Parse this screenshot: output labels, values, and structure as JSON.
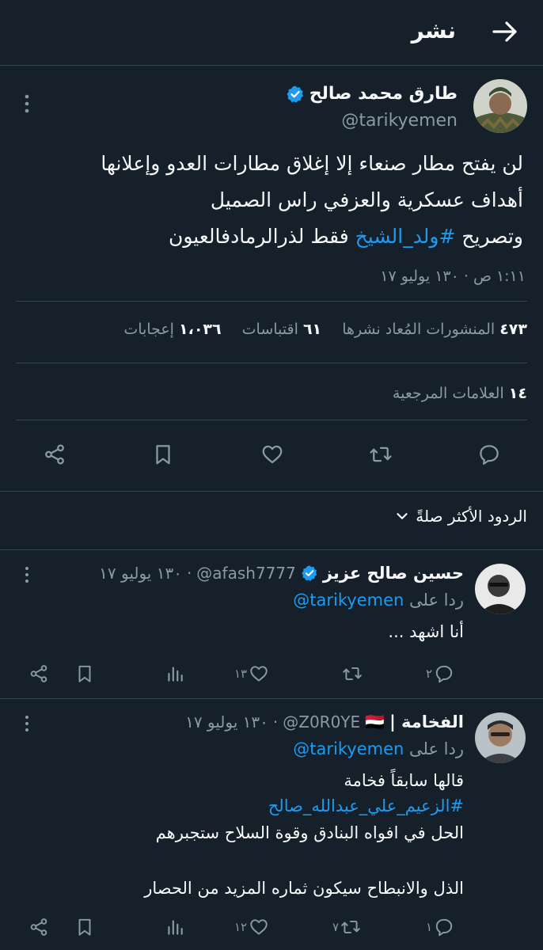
{
  "header": {
    "title": "نشر"
  },
  "tweet": {
    "name": "طارق محمد صالح",
    "handle": "@tarikyemen",
    "lines": [
      "لن يفتح مطار صنعاء إلا إغلاق  مطارات العدو وإعلانها",
      "أهداف عسكرية والعزفي راس الصميل",
      {
        "pre": "وتصريح  ",
        "hashtag": "#ولد_الشيخ",
        "post": " فقط لذرالرمادفالعيون"
      }
    ],
    "timestamp": "١:١١ ص · ١٣٠ يوليو ١٧",
    "stats": {
      "reposts_count": "٤٧٣",
      "reposts_label": "المنشورات المُعاد نشرها",
      "quotes_count": "٦١",
      "quotes_label": "اقتباسات",
      "likes_count": "١،٠٣٦",
      "likes_label": "إعجابات"
    },
    "bookmarks": {
      "count": "١٤",
      "label": "العلامات المرجعية"
    }
  },
  "sort": {
    "label": "الردود الأكثر صلةً"
  },
  "replies": [
    {
      "name": "حسين صالح عزيز",
      "handle": "@afash7777",
      "date": "١٣٠ يوليو ١٧",
      "reply_to_label": "ردا على",
      "reply_to_handle": "@tarikyemen",
      "text": "أنا اشهد ...",
      "counts": {
        "replies": "٢",
        "reposts": "",
        "likes": "١٣"
      }
    },
    {
      "name": "الفخامة |",
      "flag": "🇾🇪",
      "handle": "@Z0R0YE",
      "date": "١٣٠ يوليو ١٧",
      "reply_to_label": "ردا على",
      "reply_to_handle": "@tarikyemen",
      "line1_pre": "قالها سابقاً فخامة ",
      "line1_hashtag": "#الزعيم_علي_عبدالله_صالح",
      "line2": "الحل في افواه البنادق وقوة السلاح ستجبرهم",
      "line3": "الذل والانبطاح سيكون ثماره المزيد من الحصار",
      "counts": {
        "replies": "١",
        "reposts": "٧",
        "likes": "١٢"
      }
    }
  ],
  "icons": {
    "back": "arrow-right-icon",
    "verified": "verified-badge-icon",
    "more": "more-vertical-icon",
    "reply": "reply-icon",
    "repost": "repost-icon",
    "like": "heart-icon",
    "bookmark": "bookmark-icon",
    "share": "share-icon",
    "views": "views-icon",
    "chevron": "chevron-down-icon"
  },
  "colors": {
    "background": "#15202b",
    "text": "#f7f9f9",
    "muted": "#8b98a5",
    "accent": "#1d9bf0",
    "border": "#38444d"
  }
}
